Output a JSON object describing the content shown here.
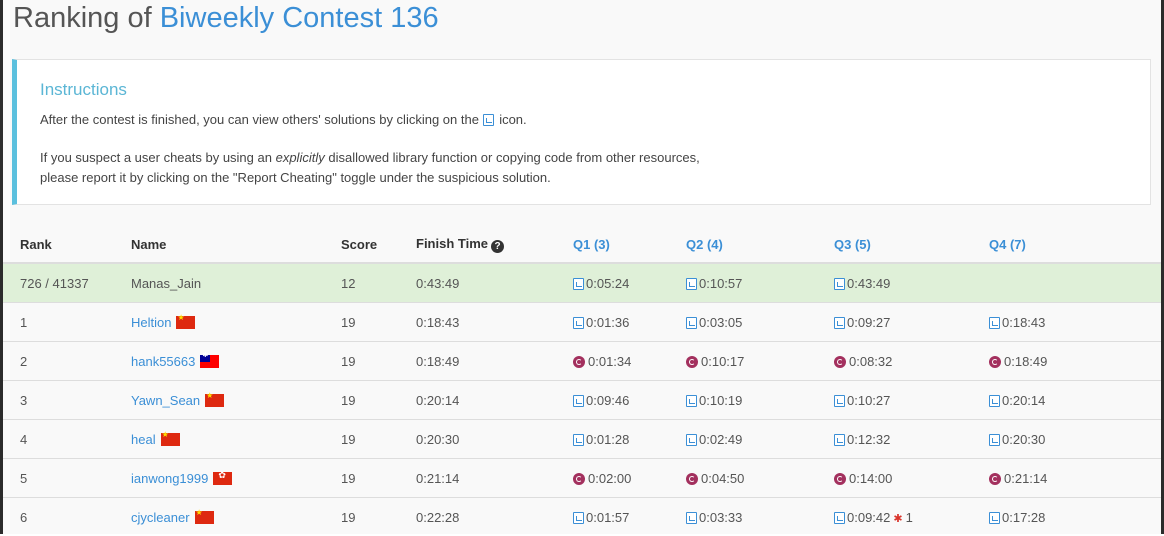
{
  "title": {
    "prefix": "Ranking of",
    "contest": "Biweekly Contest 136"
  },
  "instructions": {
    "heading": "Instructions",
    "p1_before": "After the contest is finished, you can view others' solutions by clicking on the",
    "p1_after": "icon.",
    "p2_part1": "If you suspect a user cheats by using an",
    "p2_emph": "explicitly",
    "p2_part2": "disallowed library function or copying code from other resources,",
    "p2_line2": "please report it by clicking on the \"Report Cheating\" toggle under the suspicious solution."
  },
  "table": {
    "headers": {
      "rank": "Rank",
      "name": "Name",
      "score": "Score",
      "finish": "Finish Time",
      "q1": "Q1 (3)",
      "q2": "Q2 (4)",
      "q3": "Q3 (5)",
      "q4": "Q4 (7)"
    },
    "rows": [
      {
        "rank": "726 / 41337",
        "name": "Manas_Jain",
        "flag": "",
        "score": "12",
        "finish": "0:43:49",
        "q1": "0:05:24",
        "q2": "0:10:57",
        "q3": "0:43:49",
        "q4": "",
        "lang": "code",
        "highlight": true
      },
      {
        "rank": "1",
        "name": "Heltion",
        "flag": "cn",
        "score": "19",
        "finish": "0:18:43",
        "q1": "0:01:36",
        "q2": "0:03:05",
        "q3": "0:09:27",
        "q4": "0:18:43",
        "lang": "code"
      },
      {
        "rank": "2",
        "name": "hank55663",
        "flag": "tw",
        "score": "19",
        "finish": "0:18:49",
        "q1": "0:01:34",
        "q2": "0:10:17",
        "q3": "0:08:32",
        "q4": "0:18:49",
        "lang": "cpp"
      },
      {
        "rank": "3",
        "name": "Yawn_Sean",
        "flag": "cn",
        "score": "19",
        "finish": "0:20:14",
        "q1": "0:09:46",
        "q2": "0:10:19",
        "q3": "0:10:27",
        "q4": "0:20:14",
        "lang": "code"
      },
      {
        "rank": "4",
        "name": "heal",
        "flag": "cn",
        "score": "19",
        "finish": "0:20:30",
        "q1": "0:01:28",
        "q2": "0:02:49",
        "q3": "0:12:32",
        "q4": "0:20:30",
        "lang": "code"
      },
      {
        "rank": "5",
        "name": "ianwong1999",
        "flag": "hk",
        "score": "19",
        "finish": "0:21:14",
        "q1": "0:02:00",
        "q2": "0:04:50",
        "q3": "0:14:00",
        "q4": "0:21:14",
        "lang": "cpp"
      },
      {
        "rank": "6",
        "name": "cjycleaner",
        "flag": "cn",
        "score": "19",
        "finish": "0:22:28",
        "q1": "0:01:57",
        "q2": "0:03:33",
        "q3": "0:09:42",
        "q3_penalty": "1",
        "q4": "0:17:28",
        "lang": "code"
      }
    ]
  },
  "colors": {
    "accent": "#3b8fd6",
    "info": "#5bc0de",
    "highlight_row": "#dff0d8",
    "cpp_icon": "#a3305e"
  },
  "icons": {
    "solution": "code-file-icon",
    "cpp": "cpp-language-icon",
    "bug": "bug-icon",
    "help": "question-circle-icon"
  }
}
